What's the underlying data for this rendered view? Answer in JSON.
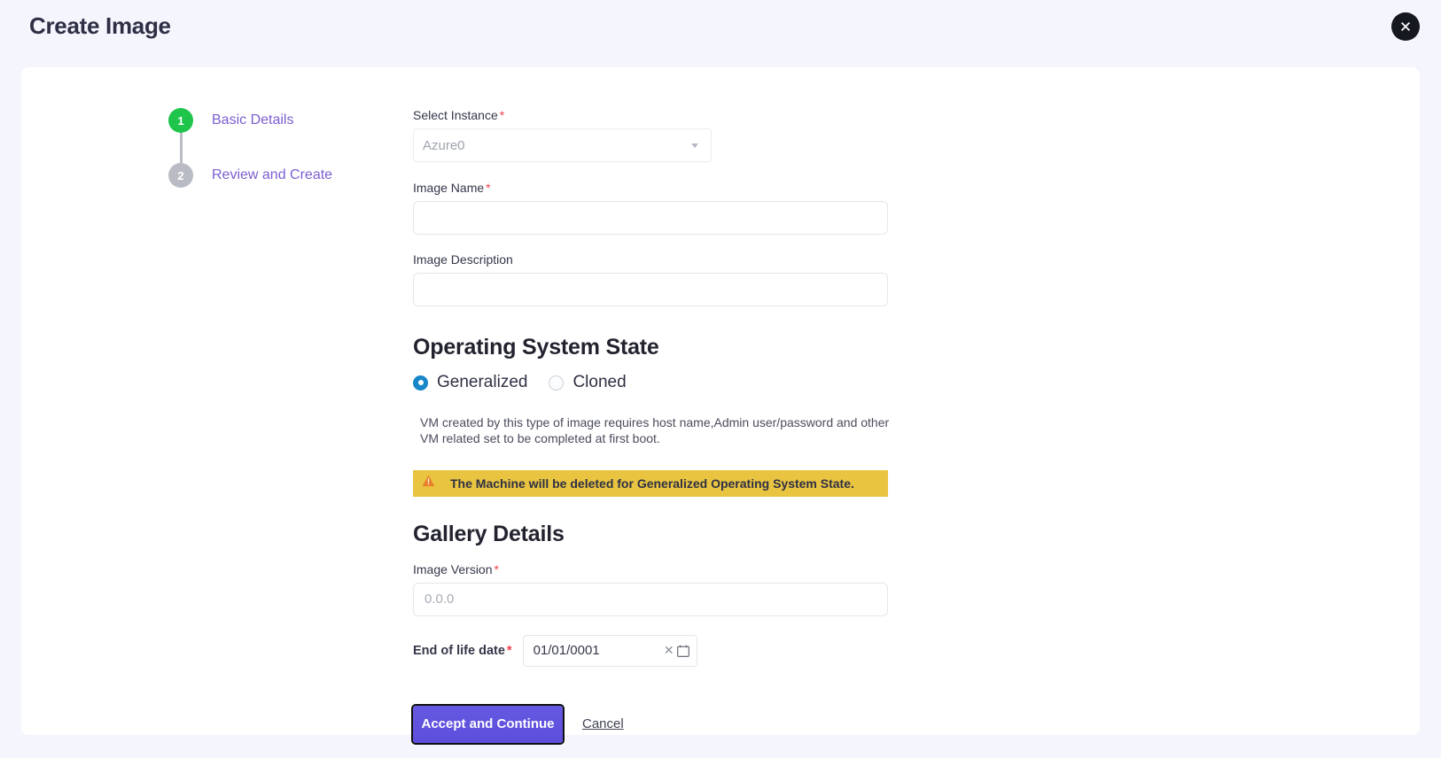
{
  "header": {
    "title": "Create Image",
    "close_icon": "close-icon"
  },
  "stepper": {
    "steps": [
      {
        "number": "1",
        "label": "Basic Details",
        "state": "active"
      },
      {
        "number": "2",
        "label": "Review and Create",
        "state": "inactive"
      }
    ]
  },
  "form": {
    "select_instance": {
      "label": "Select Instance",
      "required": "*",
      "value": "Azure0",
      "caret_icon": "chevron-down-icon"
    },
    "image_name": {
      "label": "Image Name",
      "required": "*",
      "value": "",
      "placeholder": ""
    },
    "image_description": {
      "label": "Image Description",
      "value": "",
      "placeholder": ""
    },
    "os_state": {
      "heading": "Operating System State",
      "options": [
        {
          "label": "Generalized",
          "selected": true
        },
        {
          "label": "Cloned",
          "selected": false
        }
      ],
      "help_text": "VM created by this type of image requires host name,Admin user/password and other VM related set to be completed at first boot.",
      "warning": {
        "icon": "warning-triangle-icon",
        "text": "The Machine will be deleted for Generalized Operating System State."
      }
    },
    "gallery": {
      "heading": "Gallery Details",
      "image_version": {
        "label": "Image Version",
        "required": "*",
        "value": "",
        "placeholder": "0.0.0"
      },
      "end_of_life": {
        "label": "End of life date",
        "required": "*",
        "value": "01/01/0001",
        "clear_icon": "clear-icon",
        "calendar_icon": "calendar-icon"
      }
    }
  },
  "actions": {
    "primary": "Accept and Continue",
    "secondary": "Cancel"
  },
  "colors": {
    "page_bg": "#f5f5fd",
    "card_bg": "#ffffff",
    "step_active": "#1ec54a",
    "step_inactive": "#b9bcc4",
    "step_label": "#7b5ed1",
    "required": "#f5404d",
    "radio_on": "#1787c9",
    "warning_bg": "#e8c441",
    "primary_btn": "#6053de"
  }
}
